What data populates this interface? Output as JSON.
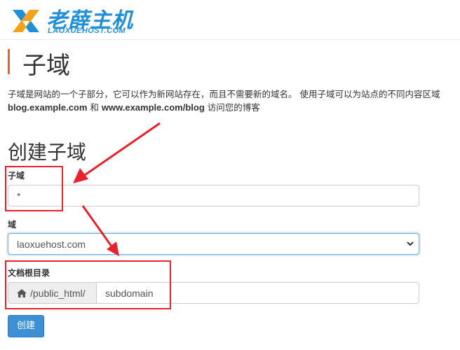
{
  "brand": {
    "name_cn": "老薛主机",
    "name_en": "LAOXUEHOST.COM"
  },
  "page": {
    "title": "子域",
    "description_line1": "子域是网站的一个子部分，它可以作为新网站存在，而且不需要新的域名。 使用子域可以为站点的不同内容区域",
    "description_example1": "blog.example.com",
    "description_and": " 和 ",
    "description_example2": "www.example.com/blog",
    "description_tail": " 访问您的博客"
  },
  "form": {
    "heading": "创建子域",
    "subdomain_label": "子域",
    "subdomain_value": "*",
    "domain_label": "域",
    "domain_selected": "laoxuehost.com",
    "docroot_label": "文档根目录",
    "docroot_prefix": "/public_html/",
    "docroot_value": "subdomain",
    "create_button": "创建"
  },
  "colors": {
    "accent": "#e8612c",
    "brand_blue": "#1f8fd8",
    "button_blue": "#3d8fd6",
    "annotation_red": "#e8212b"
  },
  "icons": {
    "home": "home-icon",
    "chevron": "chevron-down-icon",
    "logo": "logo-x-icon"
  }
}
